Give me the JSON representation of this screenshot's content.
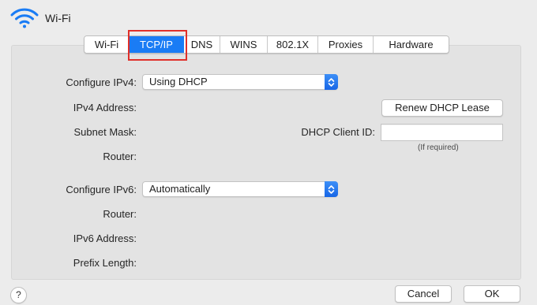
{
  "window": {
    "title": "Wi-Fi"
  },
  "tabs": [
    {
      "label": "Wi-Fi",
      "selected": false
    },
    {
      "label": "TCP/IP",
      "selected": true
    },
    {
      "label": "DNS",
      "selected": false
    },
    {
      "label": "WINS",
      "selected": false
    },
    {
      "label": "802.1X",
      "selected": false
    },
    {
      "label": "Proxies",
      "selected": false
    },
    {
      "label": "Hardware",
      "selected": false
    }
  ],
  "ipv4": {
    "configure_label": "Configure IPv4:",
    "configure_value": "Using DHCP",
    "address_label": "IPv4 Address:",
    "subnet_label": "Subnet Mask:",
    "router_label": "Router:",
    "renew_button": "Renew DHCP Lease",
    "client_id_label": "DHCP Client ID:",
    "client_id_value": "",
    "client_id_hint": "(If required)"
  },
  "ipv6": {
    "configure_label": "Configure IPv6:",
    "configure_value": "Automatically",
    "router_label": "Router:",
    "address_label": "IPv6 Address:",
    "prefix_label": "Prefix Length:"
  },
  "footer": {
    "help_label": "?",
    "cancel_label": "Cancel",
    "ok_label": "OK"
  },
  "colors": {
    "accent": "#1a7cf5",
    "highlight": "#e0302a",
    "wifi_icon": "#1a7cf5"
  }
}
